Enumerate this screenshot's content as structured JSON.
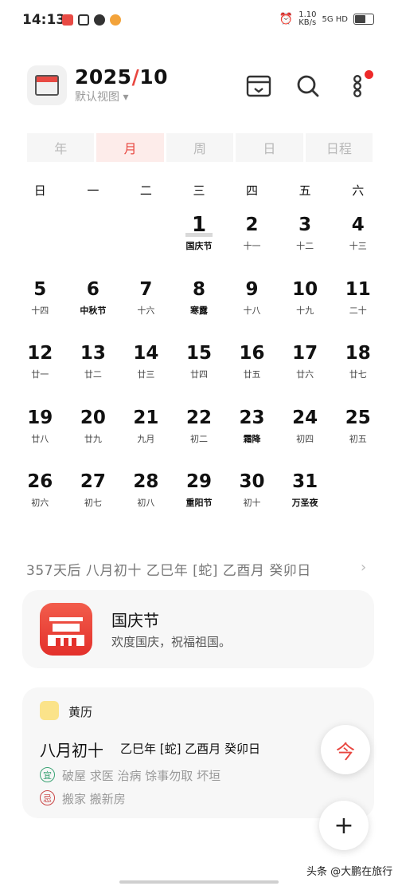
{
  "status": {
    "time": "14:13",
    "net": "1.10\nKB/s",
    "sig": "5G HD"
  },
  "header": {
    "year": "2025",
    "sep": "/",
    "month": "10",
    "view_label": "默认视图",
    "view_arrow": "▾"
  },
  "tabs": [
    {
      "label": "年",
      "active": false
    },
    {
      "label": "月",
      "active": true
    },
    {
      "label": "周",
      "active": false
    },
    {
      "label": "日",
      "active": false
    },
    {
      "label": "日程",
      "active": false
    }
  ],
  "weekdays": [
    "日",
    "一",
    "二",
    "三",
    "四",
    "五",
    "六"
  ],
  "days": [
    {
      "d": "",
      "l": ""
    },
    {
      "d": "",
      "l": ""
    },
    {
      "d": "",
      "l": ""
    },
    {
      "d": "1",
      "l": "国庆节",
      "hol": true,
      "today": true
    },
    {
      "d": "2",
      "l": "十一"
    },
    {
      "d": "3",
      "l": "十二"
    },
    {
      "d": "4",
      "l": "十三"
    },
    {
      "d": "5",
      "l": "十四"
    },
    {
      "d": "6",
      "l": "中秋节",
      "hol": true
    },
    {
      "d": "7",
      "l": "十六"
    },
    {
      "d": "8",
      "l": "寒露",
      "hol": true
    },
    {
      "d": "9",
      "l": "十八"
    },
    {
      "d": "10",
      "l": "十九"
    },
    {
      "d": "11",
      "l": "二十"
    },
    {
      "d": "12",
      "l": "廿一"
    },
    {
      "d": "13",
      "l": "廿二"
    },
    {
      "d": "14",
      "l": "廿三"
    },
    {
      "d": "15",
      "l": "廿四"
    },
    {
      "d": "16",
      "l": "廿五"
    },
    {
      "d": "17",
      "l": "廿六"
    },
    {
      "d": "18",
      "l": "廿七"
    },
    {
      "d": "19",
      "l": "廿八"
    },
    {
      "d": "20",
      "l": "廿九"
    },
    {
      "d": "21",
      "l": "九月"
    },
    {
      "d": "22",
      "l": "初二"
    },
    {
      "d": "23",
      "l": "霜降",
      "hol": true
    },
    {
      "d": "24",
      "l": "初四"
    },
    {
      "d": "25",
      "l": "初五"
    },
    {
      "d": "26",
      "l": "初六"
    },
    {
      "d": "27",
      "l": "初七"
    },
    {
      "d": "28",
      "l": "初八"
    },
    {
      "d": "29",
      "l": "重阳节",
      "hol": true
    },
    {
      "d": "30",
      "l": "初十"
    },
    {
      "d": "31",
      "l": "万圣夜",
      "hol": true
    }
  ],
  "info": {
    "text": "357天后  八月初十  乙巳年 [蛇] 乙酉月 癸卯日",
    "arrow": "›"
  },
  "holiday_card": {
    "title": "国庆节",
    "subtitle": "欢度国庆，祝福祖国。"
  },
  "almanac": {
    "title": "黄历",
    "lunar": "八月初十",
    "ganzhi": "乙巳年 [蛇] 乙酉月 癸卯日",
    "yi_badge": "宜",
    "yi": "破屋 求医 治病 馀事勿取 坏垣",
    "ji_badge": "忌",
    "ji": "搬家 搬新房"
  },
  "fab": {
    "today": "今",
    "add": "+"
  },
  "watermark": "头条 @大鹏在旅行",
  "colors": {
    "accent": "#e8463f",
    "tab_active_bg": "#fdecea",
    "card_bg": "#f7f7f7",
    "yi": "#3ba374",
    "ji": "#c94545"
  }
}
